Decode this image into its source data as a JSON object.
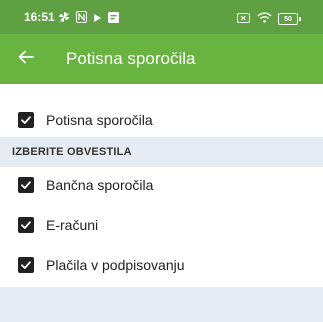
{
  "status_bar": {
    "time": "16:51",
    "battery": "50",
    "icons_left": [
      "fan-icon",
      "n-icon",
      "play-icon",
      "message-icon"
    ],
    "icons_right": [
      "battery-x-icon",
      "wifi-icon",
      "battery-icon"
    ]
  },
  "app_bar": {
    "title": "Potisna sporočila",
    "back_icon": "arrow-left-icon"
  },
  "main_toggle": {
    "label": "Potisna sporočila",
    "checked": true
  },
  "section": {
    "title": "IZBERITE OBVESTILA"
  },
  "options": [
    {
      "label": "Bančna sporočila",
      "checked": true
    },
    {
      "label": "E-računi",
      "checked": true
    },
    {
      "label": "Plačila v podpisovanju",
      "checked": true
    }
  ],
  "colors": {
    "status_bar": "#5fa043",
    "app_bar": "#69b440",
    "section_bg": "#e6eaf2",
    "checkbox": "#222222"
  }
}
